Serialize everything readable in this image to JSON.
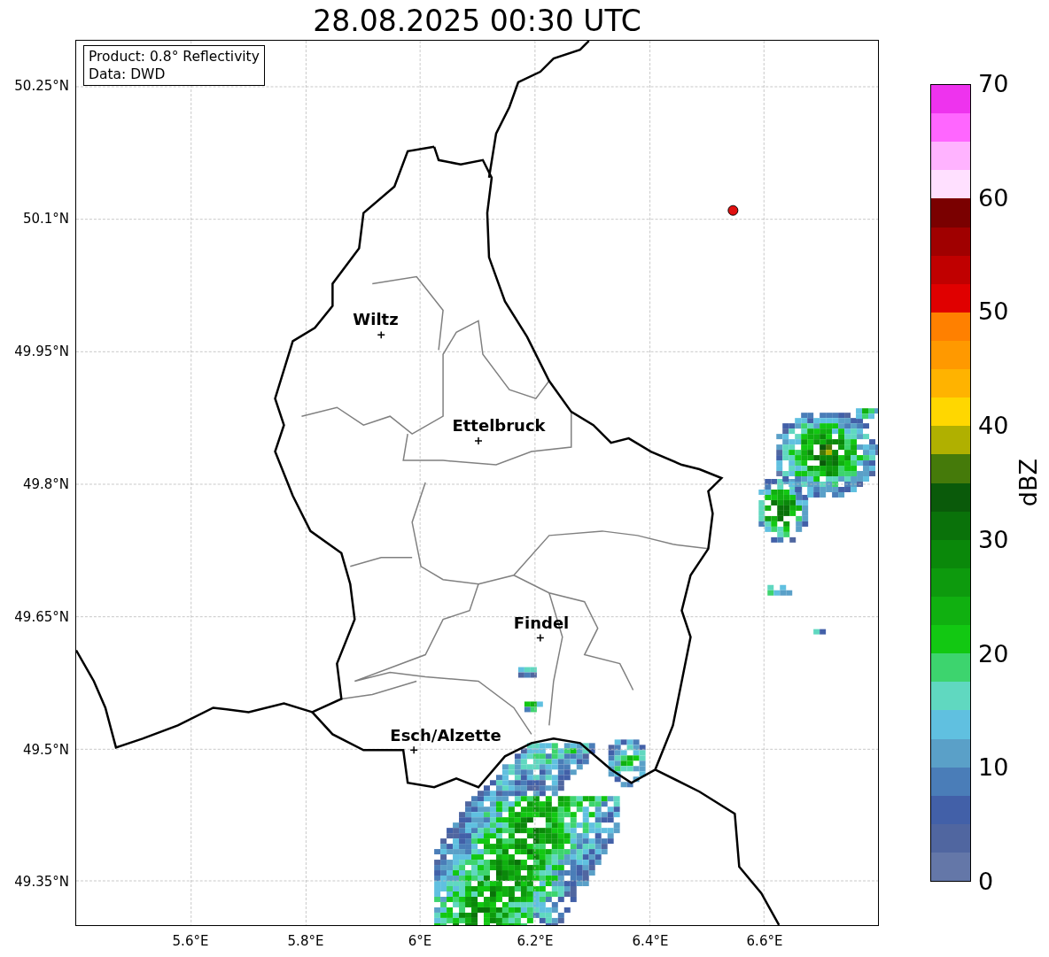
{
  "title": "28.08.2025 00:30 UTC",
  "info_box": [
    "Product: 0.8° Reflectivity",
    "Data: DWD"
  ],
  "lat_ticks": [
    "50.25°N",
    "50.1°N",
    "49.95°N",
    "49.8°N",
    "49.65°N",
    "49.5°N",
    "49.35°N"
  ],
  "lon_ticks": [
    "5.6°E",
    "5.8°E",
    "6°E",
    "6.2°E",
    "6.4°E",
    "6.6°E"
  ],
  "cities": [
    {
      "name": "Wiltz"
    },
    {
      "name": "Ettelbruck"
    },
    {
      "name": "Findel"
    },
    {
      "name": "Esch/Alzette"
    }
  ],
  "colorbar": {
    "label": "dBZ",
    "ticks": [
      "70",
      "60",
      "50",
      "40",
      "30",
      "20",
      "10",
      "0"
    ],
    "bands": [
      {
        "color": "#ee33ee"
      },
      {
        "color": "#ff66ff"
      },
      {
        "color": "#ffb3ff"
      },
      {
        "color": "#ffe0ff"
      },
      {
        "color": "#7a0000"
      },
      {
        "color": "#a00000"
      },
      {
        "color": "#c00000"
      },
      {
        "color": "#e00000"
      },
      {
        "color": "#ff8000"
      },
      {
        "color": "#ff9900"
      },
      {
        "color": "#ffb300"
      },
      {
        "color": "#ffd700"
      },
      {
        "color": "#b0b000"
      },
      {
        "color": "#457a0a"
      },
      {
        "color": "#0a5a0a"
      },
      {
        "color": "#0a720a"
      },
      {
        "color": "#0a880a"
      },
      {
        "color": "#0d9a0d"
      },
      {
        "color": "#10b010"
      },
      {
        "color": "#12c812"
      },
      {
        "color": "#3dd46e"
      },
      {
        "color": "#60d8c0"
      },
      {
        "color": "#60c0e0"
      },
      {
        "color": "#5aa0c8"
      },
      {
        "color": "#4a7db8"
      },
      {
        "color": "#4260a8"
      },
      {
        "color": "#5066a0"
      },
      {
        "color": "#6477a8"
      }
    ]
  }
}
